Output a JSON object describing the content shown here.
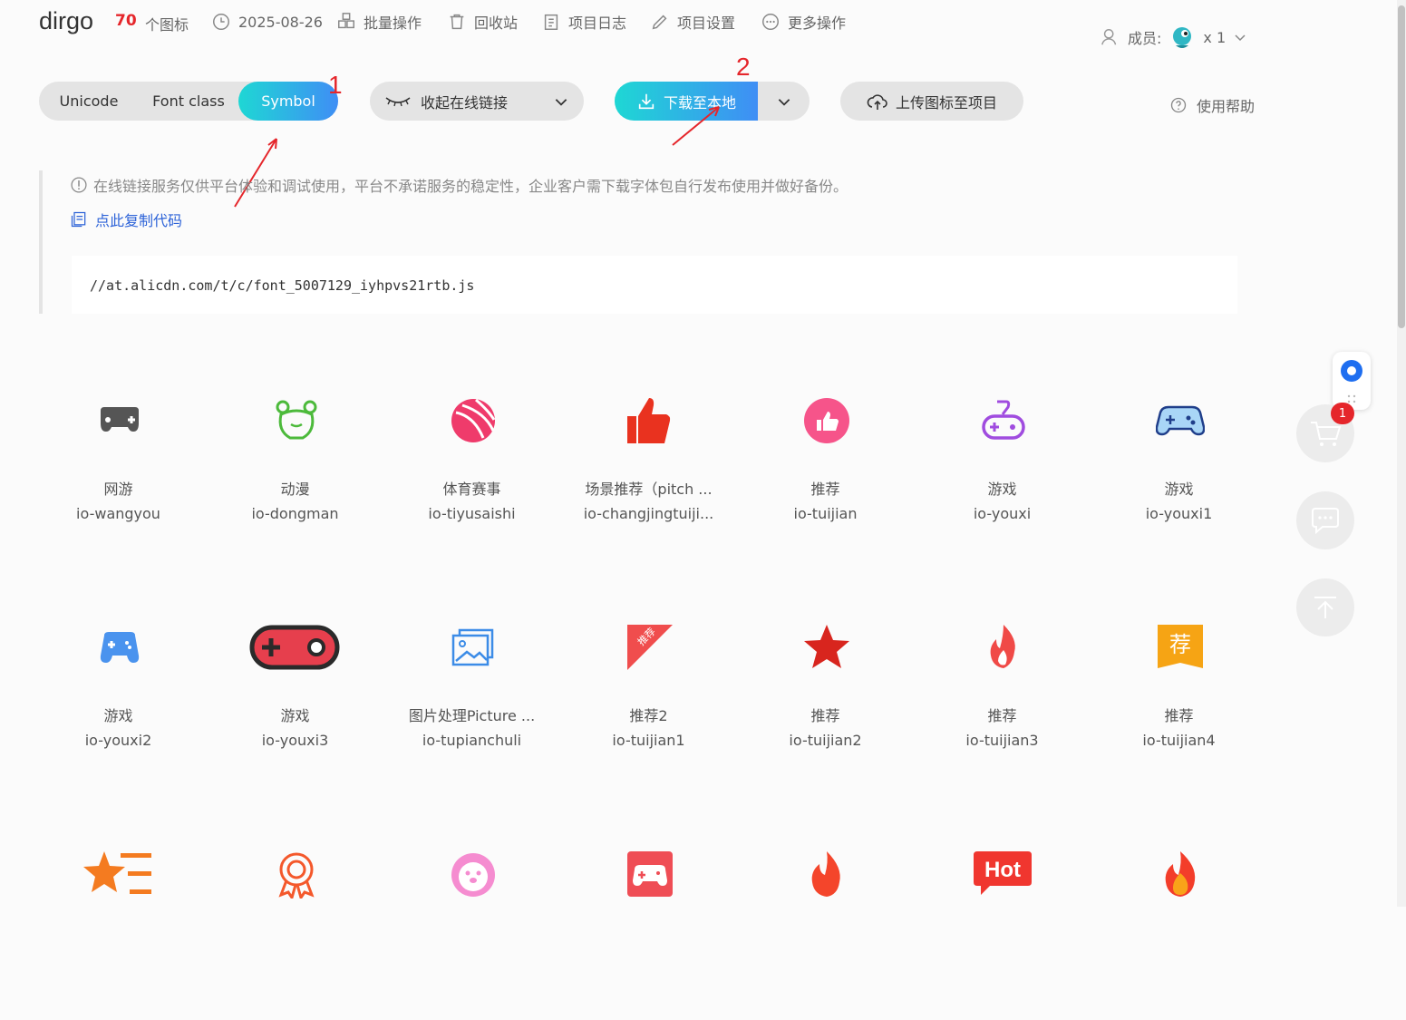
{
  "header": {
    "project_name": "dirgo",
    "icon_count": "70",
    "icon_count_label": "个图标",
    "date": "2025-08-26",
    "batch_ops": "批量操作",
    "recycle_bin": "回收站",
    "project_log": "项目日志",
    "project_settings": "项目设置",
    "more_ops": "更多操作",
    "members_label": "成员:",
    "members_count": "x 1"
  },
  "toolbar": {
    "tabs": [
      "Unicode",
      "Font class",
      "Symbol"
    ],
    "active_tab": "Symbol",
    "collapse_link": "收起在线链接",
    "download": "下载至本地",
    "upload": "上传图标至项目",
    "help": "使用帮助"
  },
  "annotations": {
    "one": "1",
    "two": "2"
  },
  "notice": {
    "text": "在线链接服务仅供平台体验和调试使用，平台不承诺服务的稳定性，企业客户需下载字体包自行发布使用并做好备份。",
    "copy": "点此复制代码",
    "code": "//at.alicdn.com/t/c/font_5007129_iyhpvs21rtb.js"
  },
  "icons": [
    {
      "name": "网游",
      "code": "io-wangyou",
      "icon": "gamepad-icon",
      "color": "#555555"
    },
    {
      "name": "动漫",
      "code": "io-dongman",
      "icon": "bear-outline-icon",
      "color": "#4cba3b"
    },
    {
      "name": "体育赛事",
      "code": "io-tiyusaishi",
      "icon": "basketball-icon",
      "color": "#ef3b6b"
    },
    {
      "name": "场景推荐（pitch ...",
      "code": "io-changjingtuiji...",
      "icon": "thumbs-up-icon",
      "color": "#e9321f"
    },
    {
      "name": "推荐",
      "code": "io-tuijian",
      "icon": "thumb-circle-icon",
      "color": "#f6548a"
    },
    {
      "name": "游戏",
      "code": "io-youxi",
      "icon": "joystick-icon",
      "color": "#a04cdf"
    },
    {
      "name": "游戏",
      "code": "io-youxi1",
      "icon": "gamepad-blue-icon",
      "color": "#3c8ce7"
    },
    {
      "name": "游戏",
      "code": "io-youxi2",
      "icon": "gamepad-small-icon",
      "color": "#4a93ee"
    },
    {
      "name": "游戏",
      "code": "io-youxi3",
      "icon": "gamepad-red-icon",
      "color": "#e63f4d"
    },
    {
      "name": "图片处理Picture ...",
      "code": "io-tupianchuli",
      "icon": "pictures-icon",
      "color": "#3c8ce7"
    },
    {
      "name": "推荐2",
      "code": "io-tuijian1",
      "icon": "corner-ribbon-icon",
      "color": "#f04d4d"
    },
    {
      "name": "推荐",
      "code": "io-tuijian2",
      "icon": "star-icon",
      "color": "#d8251e"
    },
    {
      "name": "推荐",
      "code": "io-tuijian3",
      "icon": "flame-icon",
      "color": "#f04a47"
    },
    {
      "name": "推荐",
      "code": "io-tuijian4",
      "icon": "recommend-tag-icon",
      "color": "#f6a414"
    },
    {
      "name": "",
      "code": "",
      "icon": "star-list-icon",
      "color": "#f47b20"
    },
    {
      "name": "",
      "code": "",
      "icon": "medal-icon",
      "color": "#f4582b"
    },
    {
      "name": "",
      "code": "",
      "icon": "bear-face-icon",
      "color": "#f58cd0"
    },
    {
      "name": "",
      "code": "",
      "icon": "game-card-icon",
      "color": "#ef4d55"
    },
    {
      "name": "",
      "code": "",
      "icon": "fire-icon",
      "color": "#f4452b"
    },
    {
      "name": "",
      "code": "",
      "icon": "hot-bubble-icon",
      "color": "#f0362f"
    },
    {
      "name": "",
      "code": "",
      "icon": "fire-gradient-icon",
      "color": "#f33d2a"
    }
  ],
  "hot_label": "Hot",
  "recommend_char": "荐",
  "ribbon_text": "推荐",
  "cart_badge": "1"
}
